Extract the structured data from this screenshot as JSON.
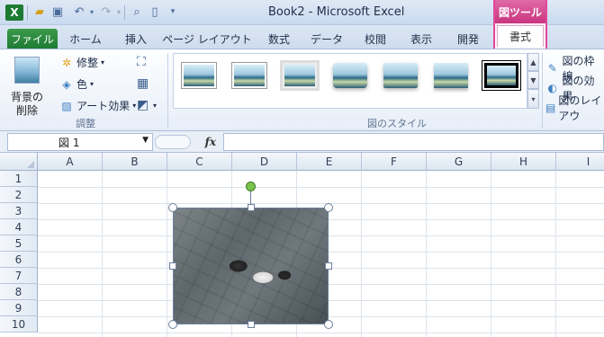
{
  "app": {
    "title": "Book2 - Microsoft Excel",
    "logo_letter": "X"
  },
  "context_tab": {
    "group_label": "図ツール",
    "tab_label": "書式"
  },
  "tabs": [
    "ファイル",
    "ホーム",
    "挿入",
    "ページ レイアウト",
    "数式",
    "データ",
    "校閲",
    "表示",
    "開発"
  ],
  "ribbon": {
    "adjust": {
      "remove_bg_line1": "背景の",
      "remove_bg_line2": "削除",
      "corrections": "修整",
      "color": "色",
      "artistic": "アート効果",
      "group_label": "調整"
    },
    "styles": {
      "group_label": "図のスタイル"
    },
    "right": {
      "border": "図の枠線",
      "effects": "図の効果",
      "layout": "図のレイアウ"
    }
  },
  "formula_bar": {
    "name_box": "図 1",
    "fx": "fx",
    "value": ""
  },
  "columns": [
    "A",
    "B",
    "C",
    "D",
    "E",
    "F",
    "G",
    "H",
    "I"
  ],
  "rows": [
    "1",
    "2",
    "3",
    "4",
    "5",
    "6",
    "7",
    "8",
    "9",
    "10"
  ]
}
